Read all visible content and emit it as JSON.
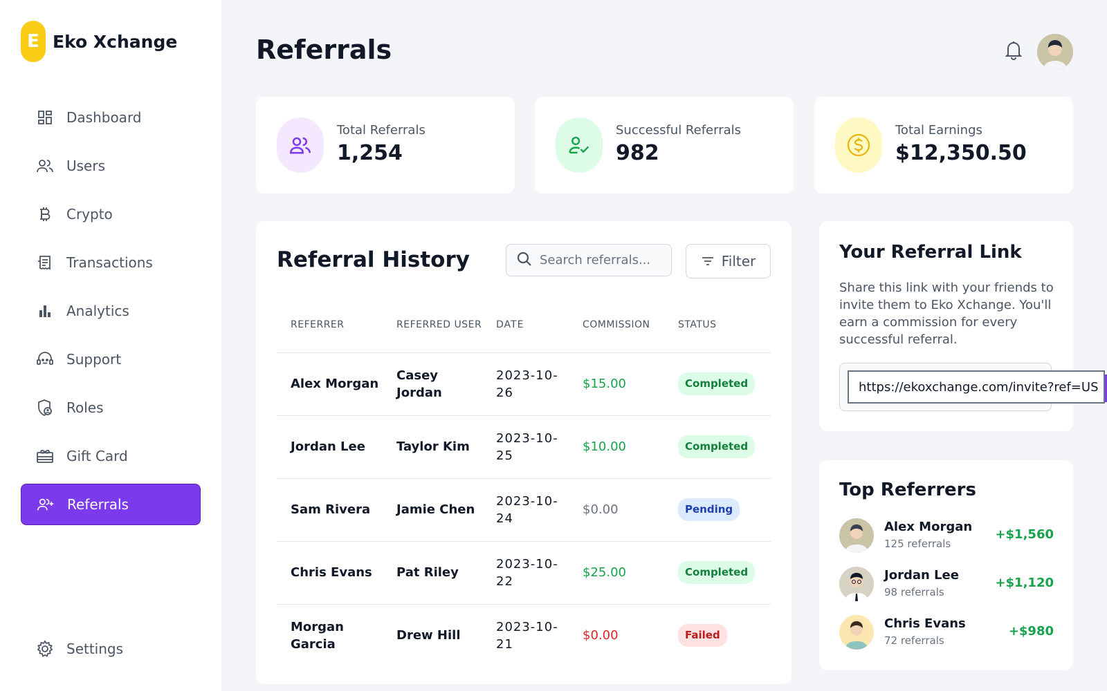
{
  "brand": {
    "logo_letter": "E",
    "name": "Eko Xchange",
    "logo_color": "#facc15"
  },
  "sidebar": {
    "items": [
      {
        "label": "Dashboard",
        "icon": "dashboard-icon"
      },
      {
        "label": "Users",
        "icon": "users-icon"
      },
      {
        "label": "Crypto",
        "icon": "bitcoin-icon"
      },
      {
        "label": "Transactions",
        "icon": "receipt-icon"
      },
      {
        "label": "Analytics",
        "icon": "bar-chart-icon"
      },
      {
        "label": "Support",
        "icon": "headset-icon"
      },
      {
        "label": "Roles",
        "icon": "shield-user-icon"
      },
      {
        "label": "Gift Card",
        "icon": "gift-card-icon"
      },
      {
        "label": "Referrals",
        "icon": "user-plus-icon",
        "active": true
      }
    ],
    "settings": {
      "label": "Settings",
      "icon": "gear-icon"
    }
  },
  "header": {
    "title": "Referrals"
  },
  "stats": [
    {
      "label": "Total Referrals",
      "value": "1,254",
      "icon": "users-icon",
      "icon_color": "#7c3aed",
      "bg": "#f3e8ff"
    },
    {
      "label": "Successful Referrals",
      "value": "982",
      "icon": "user-check-icon",
      "icon_color": "#16a34a",
      "bg": "#dcfce7"
    },
    {
      "label": "Total Earnings",
      "value": "$12,350.50",
      "icon": "dollar-coin-icon",
      "icon_color": "#eab308",
      "bg": "#fef9c3"
    }
  ],
  "history": {
    "title": "Referral History",
    "search_placeholder": "Search referrals...",
    "filter_label": "Filter",
    "columns": [
      "REFERRER",
      "REFERRED USER",
      "DATE",
      "COMMISSION",
      "STATUS"
    ],
    "rows": [
      {
        "referrer": "Alex Morgan",
        "referred": "Casey Jordan",
        "date": "2023-10-26",
        "commission": "$15.00",
        "status": "Completed"
      },
      {
        "referrer": "Jordan Lee",
        "referred": "Taylor Kim",
        "date": "2023-10-25",
        "commission": "$10.00",
        "status": "Completed"
      },
      {
        "referrer": "Sam Rivera",
        "referred": "Jamie Chen",
        "date": "2023-10-24",
        "commission": "$0.00",
        "status": "Pending"
      },
      {
        "referrer": "Chris Evans",
        "referred": "Pat Riley",
        "date": "2023-10-22",
        "commission": "$25.00",
        "status": "Completed"
      },
      {
        "referrer": "Morgan Garcia",
        "referred": "Drew Hill",
        "date": "2023-10-21",
        "commission": "$0.00",
        "status": "Failed"
      }
    ]
  },
  "referral_link": {
    "title": "Your Referral Link",
    "description": "Share this link with your friends to invite them to Eko Xchange. You'll earn a commission for every successful referral.",
    "url": "https://ekoxchange.com/invite?ref=US"
  },
  "top_referrers": {
    "title": "Top Referrers",
    "items": [
      {
        "name": "Alex Morgan",
        "count": "125 referrals",
        "amount": "+$1,560"
      },
      {
        "name": "Jordan Lee",
        "count": "98 referrals",
        "amount": "+$1,120"
      },
      {
        "name": "Chris Evans",
        "count": "72 referrals",
        "amount": "+$980"
      }
    ]
  }
}
